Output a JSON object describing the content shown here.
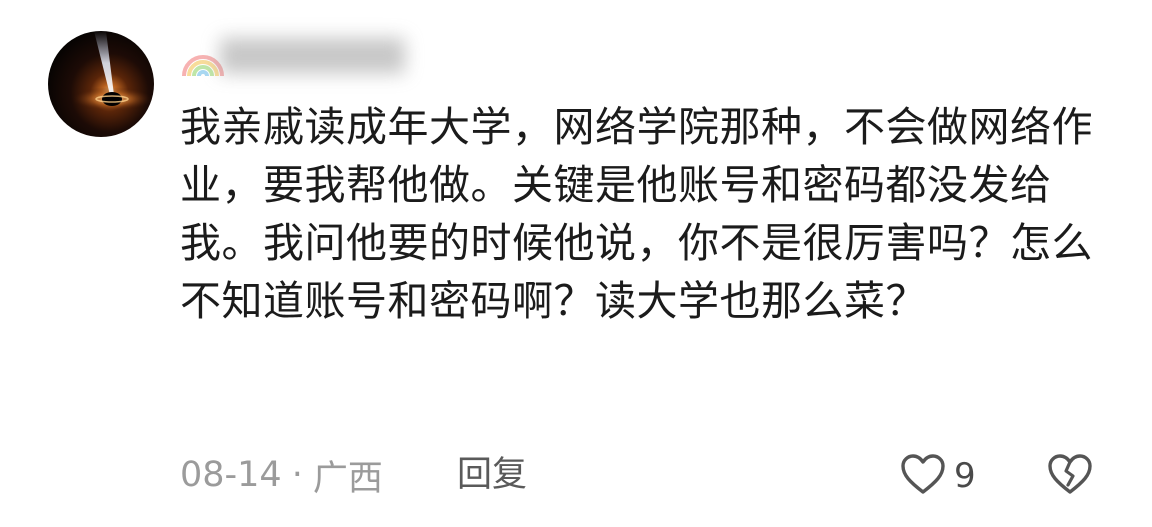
{
  "comment": {
    "username": "████████",
    "text": "我亲戚读成年大学，网络学院那种，不会做网络作业，要我帮他做。关键是他账号和密码都没发给我。我问他要的时候他说，你不是很厉害吗？怎么不知道账号和密码啊？读大学也那么菜？",
    "date": "08-14",
    "separator": "·",
    "location": "广西",
    "reply_label": "回复",
    "like_count": "9",
    "icons": {
      "avatar": "black-hole-avatar",
      "badge": "rainbow-icon",
      "like": "heart-outline-icon",
      "dislike": "broken-heart-icon"
    }
  }
}
